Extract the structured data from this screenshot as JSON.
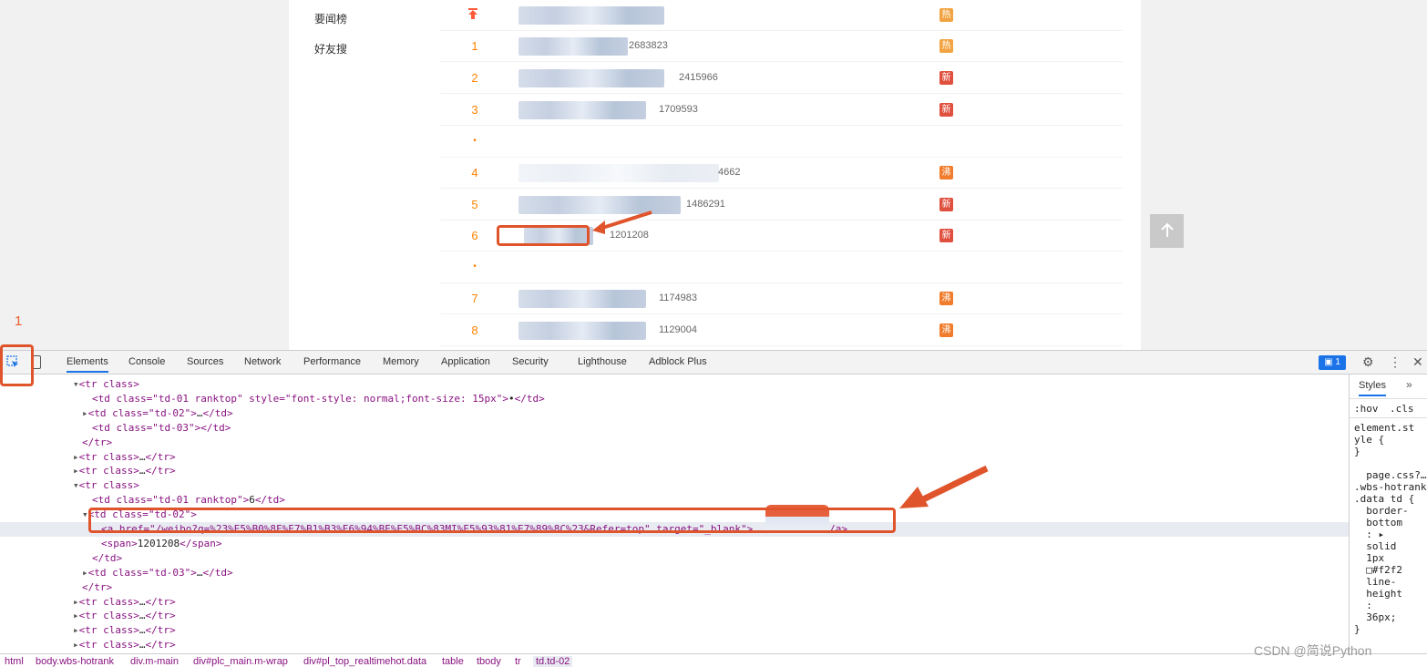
{
  "site": {
    "side_items": [
      "要闻榜",
      "好友搜"
    ],
    "rows": [
      {
        "rank": "",
        "is_top": true,
        "count": "",
        "badge": "热",
        "badge_color": "#f2a443"
      },
      {
        "rank": "1",
        "count": "2683823",
        "badge": "热",
        "badge_color": "#f2a443"
      },
      {
        "rank": "2",
        "count": "2415966",
        "badge": "新",
        "badge_color": "#e0503f"
      },
      {
        "rank": "3",
        "count": "1709593",
        "badge": "新",
        "badge_color": "#e0503f"
      },
      {
        "rank": "•",
        "count": "",
        "badge": ""
      },
      {
        "rank": "4",
        "count": "4662",
        "badge": "沸",
        "badge_color": "#f17d2c"
      },
      {
        "rank": "5",
        "count": "1486291",
        "badge": "新",
        "badge_color": "#e0503f"
      },
      {
        "rank": "6",
        "count": "1201208",
        "badge": "新",
        "badge_color": "#e0503f"
      },
      {
        "rank": "•",
        "count": "",
        "badge": ""
      },
      {
        "rank": "7",
        "count": "1174983",
        "badge": "沸",
        "badge_color": "#f17d2c"
      },
      {
        "rank": "8",
        "count": "1129004",
        "badge": "沸",
        "badge_color": "#f17d2c"
      }
    ],
    "up_icon": "arrow-up-icon"
  },
  "annotation": {
    "step_label": "1",
    "color": "#e0542b"
  },
  "devtools": {
    "tabs": [
      "Elements",
      "Console",
      "Sources",
      "Network",
      "Performance",
      "Memory",
      "Application",
      "Security",
      "Lighthouse",
      "Adblock Plus"
    ],
    "active_tab": "Elements",
    "issues_count": "1",
    "code_lines": [
      {
        "i": 0,
        "text": "▾<tr class>"
      },
      {
        "i": 1,
        "text": "<td class=\"td-01 ranktop\" style=\"font-style: normal;font-size: 15px\">•</td>"
      },
      {
        "i": 2,
        "text": "▸<td class=\"td-02\">…</td>"
      },
      {
        "i": 3,
        "text": "<td class=\"td-03\"></td>"
      },
      {
        "i": 4,
        "text": "</tr>"
      },
      {
        "i": 5,
        "text": "▸<tr class>…</tr>"
      },
      {
        "i": 6,
        "text": "▸<tr class>…</tr>"
      },
      {
        "i": 7,
        "text": "▾<tr class>"
      },
      {
        "i": 8,
        "text": "<td class=\"td-01 ranktop\">6</td>"
      },
      {
        "i": 9,
        "text": "▾<td class=\"td-02\">"
      },
      {
        "i": 10,
        "text": "<a href=\"/weibo?q=%23%E5%B0%8F%E7%B1%B3%E6%94%BE%E5%BC%83MI%E5%93%81%E7%89%8C%23&Refer=top\" target=\"_blank\">          牌</a>"
      },
      {
        "i": 11,
        "text": "<span>1201208</span>"
      },
      {
        "i": 12,
        "text": "</td>"
      },
      {
        "i": 13,
        "text": "▸<td class=\"td-03\">…</td>"
      },
      {
        "i": 14,
        "text": "</tr>"
      },
      {
        "i": 15,
        "text": "▸<tr class>…</tr>"
      },
      {
        "i": 16,
        "text": "▸<tr class>…</tr>"
      },
      {
        "i": 17,
        "text": "▸<tr class>…</tr>"
      },
      {
        "i": 18,
        "text": "▸<tr class>…</tr>"
      }
    ],
    "styles": {
      "tab": "Styles",
      "hov": ":hov",
      "cls": ".cls",
      "lines": [
        "element.st",
        "yle {",
        "}",
        "",
        "  page.css?…",
        ".wbs-hotrank",
        ".data td {",
        "  border-",
        "  bottom",
        "  : ▸",
        "  solid",
        "  1px",
        "  □#f2f2",
        "  line-",
        "  height",
        "  :",
        "  36px;",
        "}"
      ]
    },
    "breadcrumbs": [
      "html",
      "body.wbs-hotrank",
      "div.m-main",
      "div#plc_main.m-wrap",
      "div#pl_top_realtimehot.data",
      "table",
      "tbody",
      "tr",
      "td.td-02"
    ]
  },
  "watermark": "CSDN @简说Python"
}
